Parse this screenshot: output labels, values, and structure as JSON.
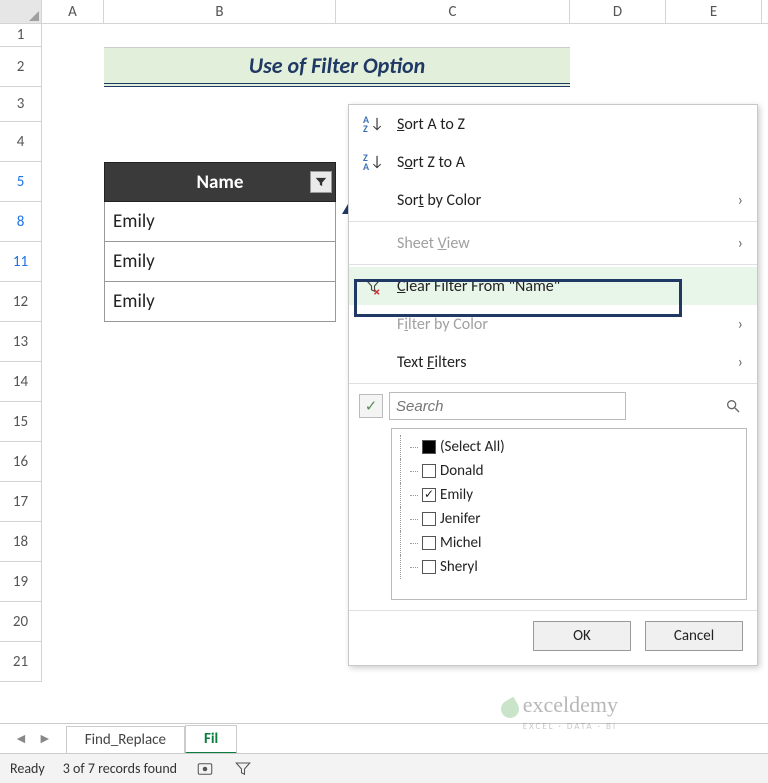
{
  "columns": [
    "A",
    "B",
    "C",
    "D",
    "E"
  ],
  "rows": [
    "1",
    "2",
    "3",
    "4",
    "5",
    "8",
    "11",
    "12",
    "13",
    "14",
    "15",
    "16",
    "17",
    "18",
    "19",
    "20",
    "21"
  ],
  "title": "Use of Filter Option",
  "table": {
    "header": "Name",
    "cells": [
      "Emily",
      "Emily",
      "Emily"
    ]
  },
  "filter_menu": {
    "sort_az": "Sort A to Z",
    "sort_za": "Sort Z to A",
    "sort_color": "Sort by Color",
    "sheet_view": "Sheet View",
    "clear_filter": "Clear Filter From \"Name\"",
    "filter_color": "Filter by Color",
    "text_filters": "Text Filters",
    "search_placeholder": "Search",
    "items": [
      {
        "label": "(Select All)",
        "state": "filled"
      },
      {
        "label": "Donald",
        "state": "empty"
      },
      {
        "label": "Emily",
        "state": "checked"
      },
      {
        "label": "Jenifer",
        "state": "empty"
      },
      {
        "label": "Michel",
        "state": "empty"
      },
      {
        "label": "Sheryl",
        "state": "empty"
      }
    ],
    "ok": "OK",
    "cancel": "Cancel"
  },
  "tabs": {
    "find_replace": "Find_Replace",
    "filter": "Fil"
  },
  "status": {
    "ready": "Ready",
    "records": "3 of 7 records found"
  },
  "watermark": {
    "brand": "exceldemy",
    "tag": "EXCEL · DATA · BI"
  }
}
